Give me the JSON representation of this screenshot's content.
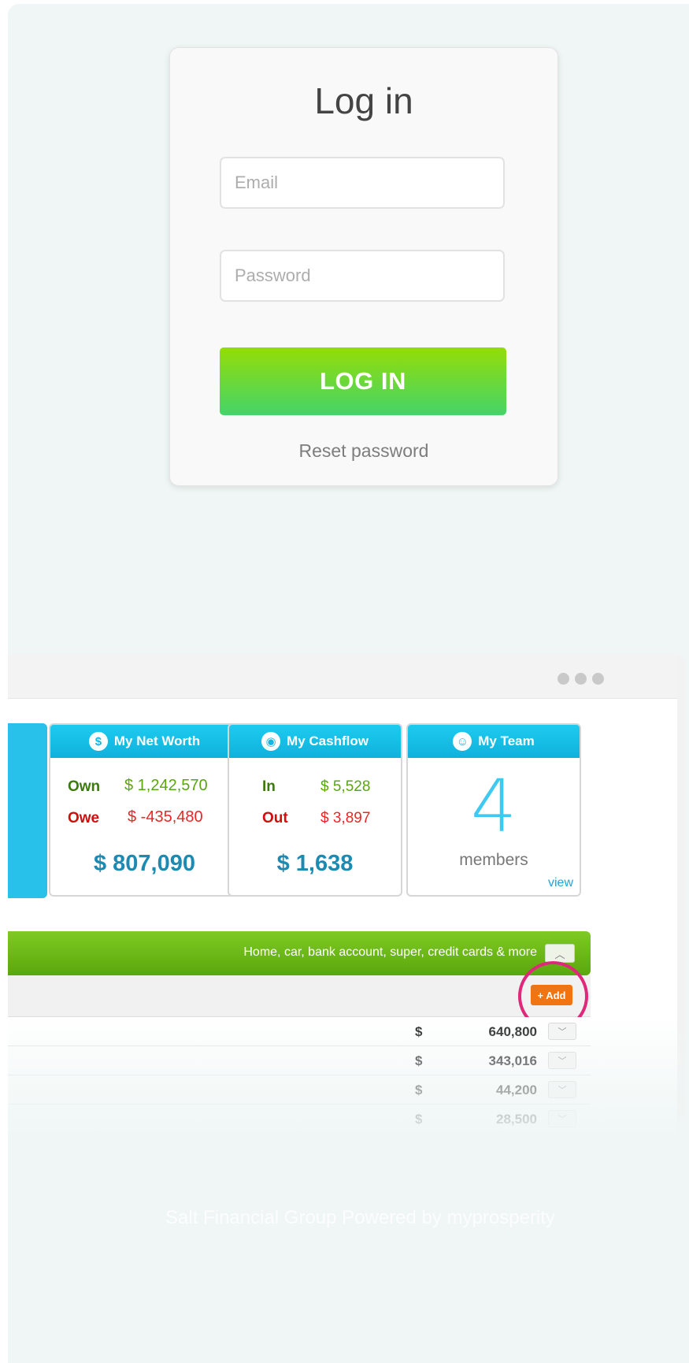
{
  "login": {
    "title": "Log in",
    "email_placeholder": "Email",
    "password_placeholder": "Password",
    "button_label": "LOG IN",
    "reset_link": "Reset password"
  },
  "dashboard": {
    "net_worth": {
      "title": "My Net Worth",
      "icon": "dollar-icon",
      "own_label": "Own",
      "own_value": "$ 1,242,570",
      "owe_label": "Owe",
      "owe_value": "$ -435,480",
      "total": "$ 807,090"
    },
    "cashflow": {
      "title": "My Cashflow",
      "icon": "camera-icon",
      "in_label": "In",
      "in_value": "$ 5,528",
      "out_label": "Out",
      "out_value": "$ 3,897",
      "total": "$ 1,638"
    },
    "team": {
      "title": "My Team",
      "icon": "team-icon",
      "count": "4",
      "members_label": "members",
      "view_link": "view"
    },
    "assets": {
      "description": "Home, car, bank account, super, credit cards & more",
      "add_label": "+ Add",
      "rows": [
        {
          "currency": "$",
          "amount": "640,800"
        },
        {
          "currency": "$",
          "amount": "343,016"
        },
        {
          "currency": "$",
          "amount": "44,200"
        },
        {
          "currency": "$",
          "amount": "28,500"
        }
      ]
    }
  },
  "footer": {
    "text": "Salt Financial Group Powered by myprosperity"
  },
  "colors": {
    "accent_blue": "#10b1dc",
    "green": "#5aa70e",
    "orange": "#f07512",
    "highlight": "#e0277a"
  }
}
